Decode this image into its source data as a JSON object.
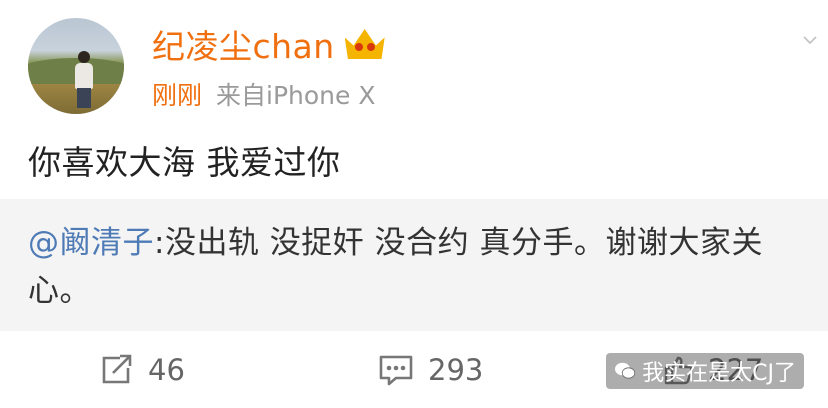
{
  "post": {
    "username": "纪凌尘chan",
    "vip_badge_icon": "vip-crown-icon",
    "time": "刚刚",
    "source": "来自iPhone X",
    "text": "你喜欢大海 我爱过你"
  },
  "repost": {
    "mention": "@阚清子",
    "text": ":没出轨 没捉奸 没合约 真分手。谢谢大家关心。"
  },
  "actions": {
    "share_icon": "share-icon",
    "share_count": "46",
    "comment_icon": "comment-icon",
    "comment_count": "293",
    "like_icon": "like-icon",
    "like_count": "227"
  },
  "watermark": {
    "icon": "wechat-icon",
    "text": "我实在是太CJ了"
  },
  "colors": {
    "username": "#f0700f",
    "mention": "#4e7bb6",
    "repost_bg": "#f4f4f4",
    "meta_gray": "#9a9a9a"
  }
}
